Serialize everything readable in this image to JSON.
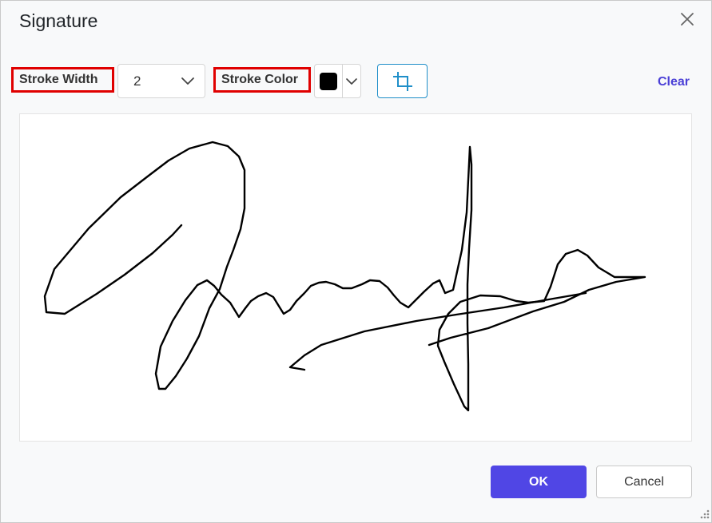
{
  "dialog": {
    "title": "Signature"
  },
  "toolbar": {
    "stroke_width_label": "Stroke Width",
    "stroke_width_value": "2",
    "stroke_color_label": "Stroke Color",
    "stroke_color_value": "#000000",
    "crop_icon": "crop-icon",
    "clear_label": "Clear"
  },
  "icons": {
    "close": "close-icon",
    "chevron": "chevron-down-icon",
    "resize": "resize-grip-icon"
  },
  "footer": {
    "ok_label": "OK",
    "cancel_label": "Cancel"
  },
  "colors": {
    "highlight_border": "#e00000",
    "primary": "#5046e5",
    "link": "#4a3fd6",
    "crop_accent": "#1f8fc9",
    "ink": "#000000"
  }
}
